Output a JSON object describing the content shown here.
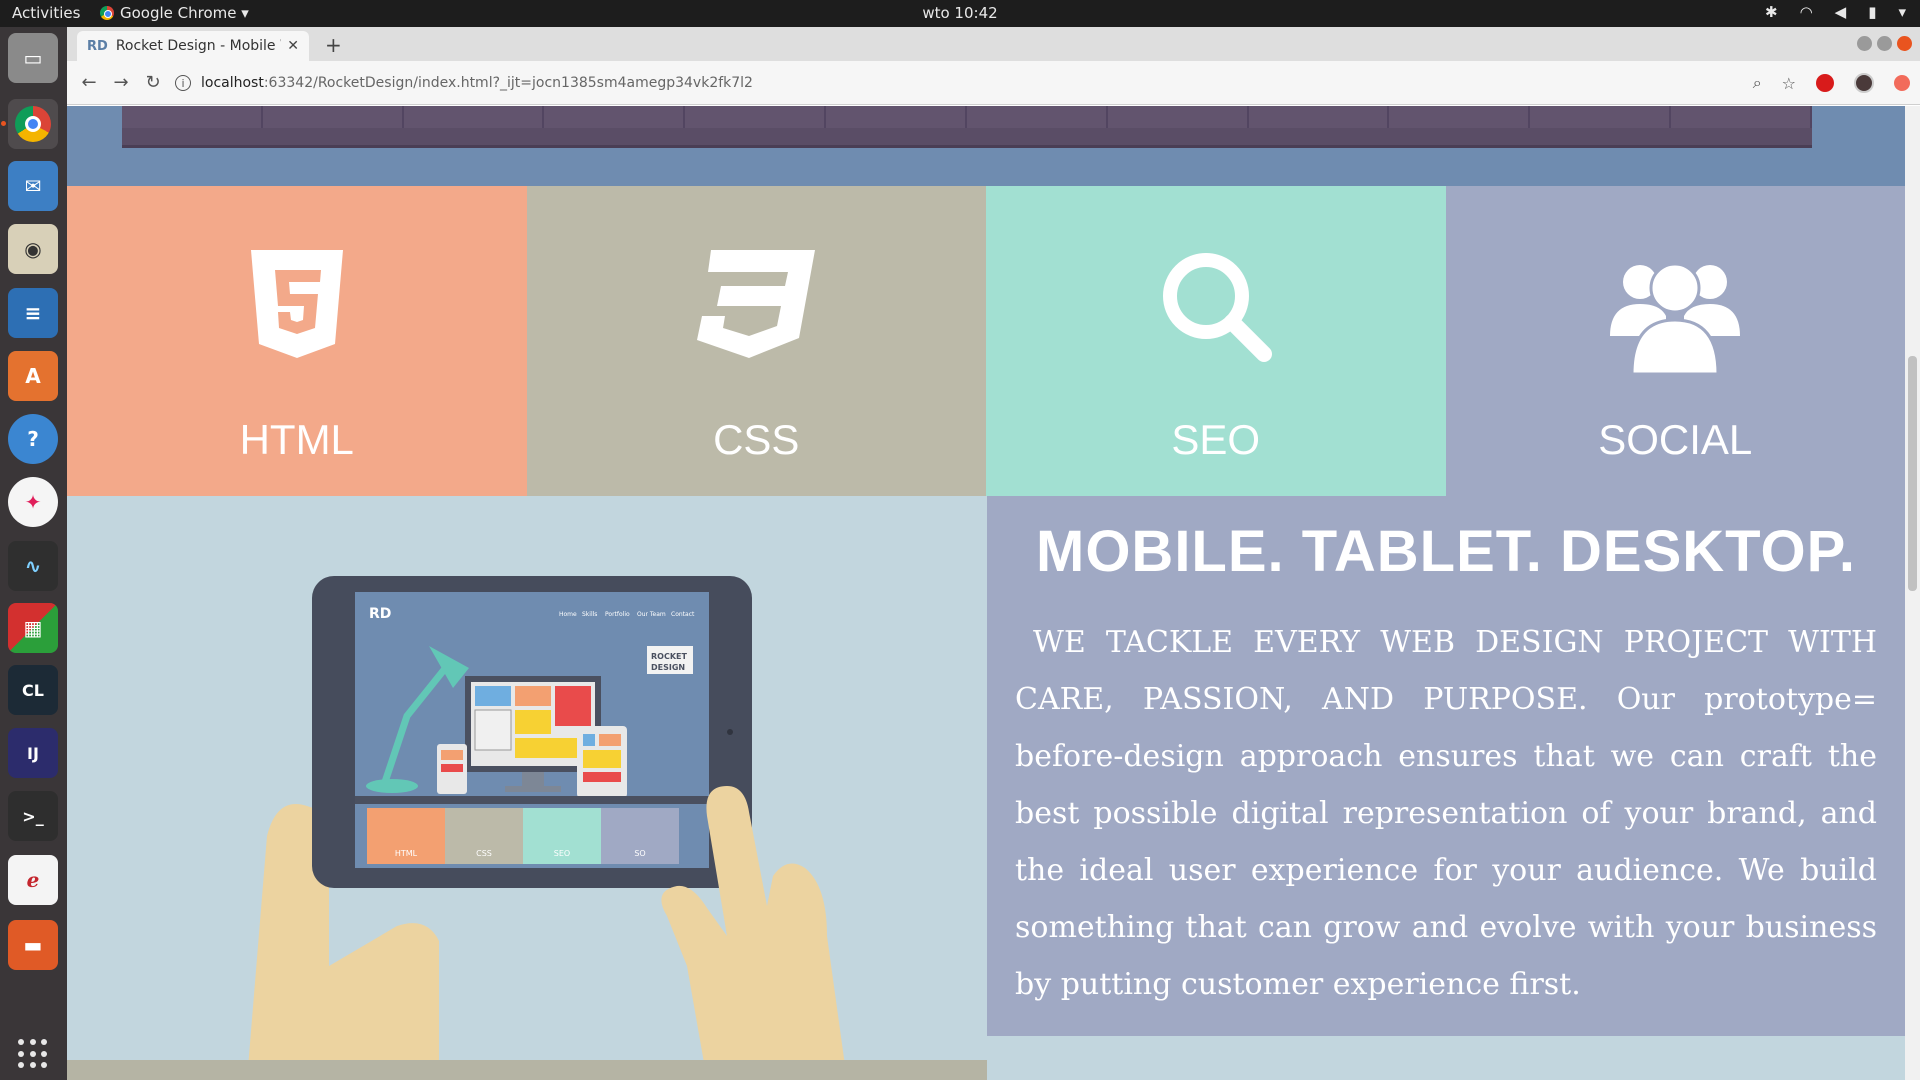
{
  "os": {
    "activities": "Activities",
    "app_menu": "Google Chrome ▾",
    "clock": "wto 10:42"
  },
  "browser": {
    "tab_title": "Rocket Design - Mobile W",
    "tab_favicon": "RD",
    "url_host": "localhost",
    "url_path": ":63342/RocketDesign/index.html?_ijt=jocn1385sm4amegp34vk2fk7l2"
  },
  "services": [
    {
      "label": "HTML",
      "color": "#f3a98a",
      "icon": "html5-icon"
    },
    {
      "label": "CSS",
      "color": "#bcbaa9",
      "icon": "css3-icon"
    },
    {
      "label": "SEO",
      "color": "#a2e0d2",
      "icon": "search-icon"
    },
    {
      "label": "SOCIAL",
      "color": "#a0a9c4",
      "icon": "users-icon"
    }
  ],
  "about": {
    "headline": "MOBILE. TABLET. DESKTOP.",
    "body": "WE TACKLE EVERY WEB DESIGN PROJECT WITH CARE, PASSION, AND PURPOSE. Our prototype= before-design approach ensures that we can craft the best possible digital representation of your brand, and the ideal user experience for your audience. We build something that can grow and evolve with your business by putting customer experience first."
  },
  "illustration": {
    "logo": "RD",
    "nav_items": [
      "Home",
      "Skills",
      "Portfolio",
      "Our Team",
      "Contact"
    ],
    "badge_line1": "ROCKET",
    "badge_line2": "DESIGN",
    "mini_tiles": [
      "HTML",
      "CSS",
      "SEO",
      "SO"
    ]
  }
}
